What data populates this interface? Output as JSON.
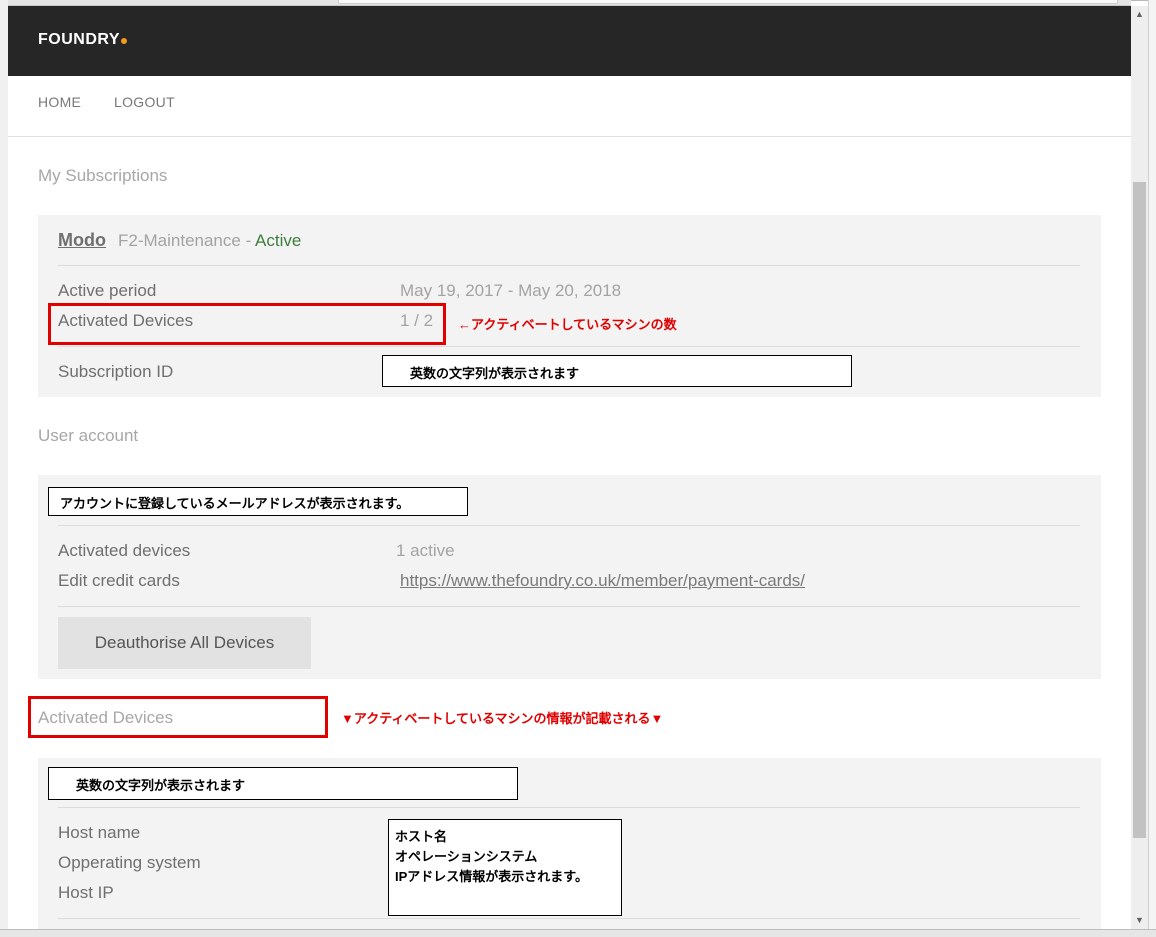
{
  "header": {
    "logo_text": "FOUNDRY",
    "logo_dot_color": "#f39a1e"
  },
  "nav": {
    "items": [
      "HOME",
      "LOGOUT"
    ]
  },
  "subscriptions": {
    "section_title": "My Subscriptions",
    "product": "Modo",
    "plan": "F2-Maintenance - ",
    "status": "Active",
    "active_period_label": "Active period",
    "active_period_value": "May 19, 2017 - May 20, 2018",
    "activated_devices_label": "Activated Devices",
    "activated_devices_value": "1 / 2",
    "activated_devices_note": "←アクティベートしているマシンの数",
    "subscription_id_label": "Subscription ID",
    "subscription_id_placeholder": "英数の文字列が表示されます"
  },
  "user_account": {
    "section_title": "User account",
    "email_placeholder": "アカウントに登録しているメールアドレスが表示されます。",
    "activated_devices_label": "Activated devices",
    "activated_devices_value": "1 active",
    "edit_cards_label": "Edit credit cards",
    "edit_cards_url": "https://www.thefoundry.co.uk/member/payment-cards/",
    "deauthorise_button": "Deauthorise All Devices"
  },
  "devices": {
    "section_title": "Activated Devices",
    "note": "▼アクティベートしているマシンの情報が記載される▼",
    "id_placeholder": "英数の文字列が表示されます",
    "host_name_label": "Host name",
    "os_label": "Opperating system",
    "host_ip_label": "Host IP",
    "info_lines": [
      "ホスト名",
      "オペレーションシステム",
      "IPアドレス情報が表示されます。"
    ]
  },
  "scrollbar": {
    "up_arrow": "▲",
    "down_arrow": "▼"
  }
}
